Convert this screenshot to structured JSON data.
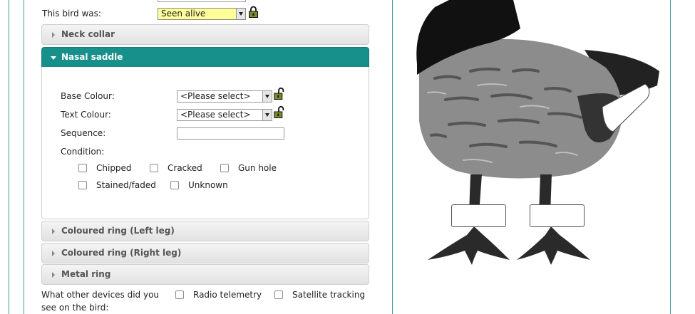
{
  "bird_status": {
    "label": "This bird was:",
    "value": "Seen alive"
  },
  "accordion": {
    "neck_collar": "Neck collar",
    "nasal_saddle": "Nasal saddle",
    "left_leg": "Coloured ring (Left leg)",
    "right_leg": "Coloured ring (Right leg)",
    "metal_ring": "Metal ring"
  },
  "nasal_form": {
    "base_colour_label": "Base Colour:",
    "base_colour_value": "<Please select>",
    "text_colour_label": "Text Colour:",
    "text_colour_value": "<Please select>",
    "sequence_label": "Sequence:",
    "sequence_value": "",
    "condition_label": "Condition:",
    "conditions": [
      "Chipped",
      "Cracked",
      "Gun hole",
      "Stained/faded",
      "Unknown"
    ]
  },
  "devices": {
    "question_line1": "What other devices did you",
    "question_line2": "see on the bird:",
    "options": [
      "Radio telemetry",
      "Satellite tracking"
    ]
  },
  "colors": {
    "accent": "#178f8b",
    "frame": "#3a9a97",
    "select_highlight": "#ffff99",
    "lock_locked": "#7b8a2a",
    "lock_unlocked": "#7b8a2a"
  }
}
